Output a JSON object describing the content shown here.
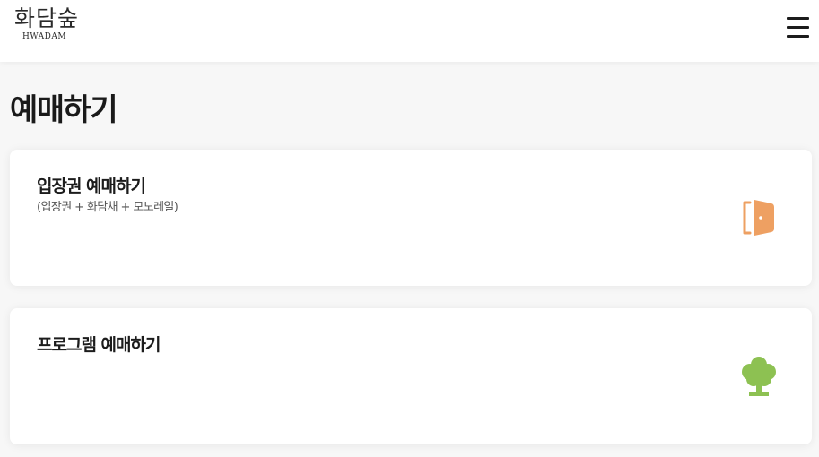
{
  "header": {
    "logo_korean": "화담숲",
    "logo_english": "HWADAM",
    "menu_icon": "hamburger-menu-icon"
  },
  "page": {
    "title": "예매하기"
  },
  "cards": [
    {
      "title": "입장권 예매하기",
      "subtitle": "(입장권 + 화담채 + 모노레일)",
      "icon": "door-icon",
      "icon_color": "#EEA062"
    },
    {
      "title": "프로그램 예매하기",
      "subtitle": "",
      "icon": "tree-icon",
      "icon_color": "#8DC152"
    }
  ],
  "colors": {
    "background": "#F7F7F7",
    "card": "#FFFFFF",
    "text": "#1C1C1C"
  }
}
